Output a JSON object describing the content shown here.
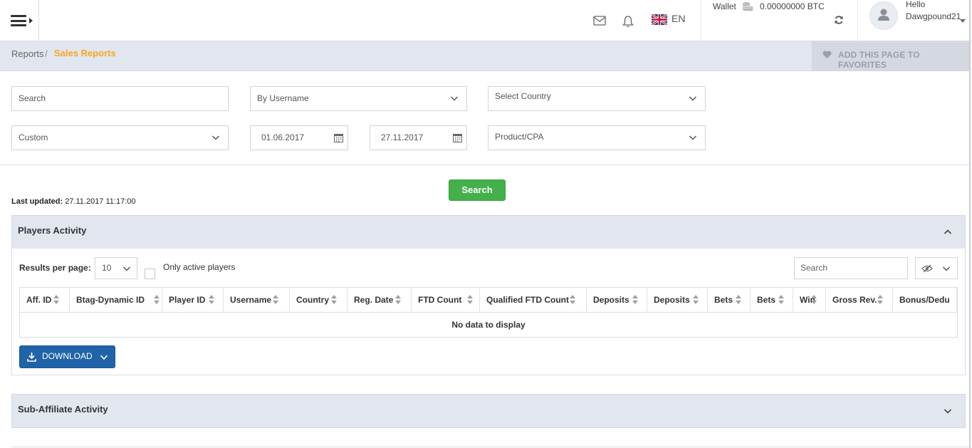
{
  "header": {
    "language": "EN",
    "wallet_label": "Wallet",
    "wallet_value": "0.00000000  BTC",
    "greeting": "Hello",
    "username": "Dawgpound21"
  },
  "breadcrumb": {
    "parent": "Reports",
    "separator": "/",
    "current": "Sales Reports",
    "favorites_label": "ADD THIS PAGE TO FAVORITES"
  },
  "filters": {
    "search_placeholder": "Search",
    "by_username": "By Username",
    "country": "Select Country",
    "period": "Custom",
    "date_from": "01.06.2017",
    "date_to": "27.11.2017",
    "product": "Product/CPA"
  },
  "search_button": "Search",
  "last_updated": {
    "label": "Last updated:",
    "value": "27.11.2017 11:17:00"
  },
  "players_activity": {
    "title": "Players Activity",
    "results_per_page_label": "Results per page:",
    "results_per_page_value": "10",
    "only_active_label": "Only active players",
    "table_search_placeholder": "Search",
    "columns": [
      "Aff. ID",
      "Btag-Dynamic ID",
      "Player ID",
      "Username",
      "Country",
      "Reg. Date",
      "FTD Count",
      "Qualified FTD Count",
      "Deposits",
      "Deposits",
      "Bets",
      "Bets",
      "Win",
      "Gross Rev.",
      "Bonus/Dedu"
    ],
    "empty_message": "No data to display",
    "download_label": "DOWNLOAD"
  },
  "sub_affiliate": {
    "title": "Sub-Affiliate Activity"
  },
  "colors": {
    "accent_orange": "#f5a623",
    "search_green": "#43b049",
    "download_blue": "#2063a8",
    "panel_bg": "#e2e6ee"
  },
  "icons": [
    "menu-icon",
    "mail-icon",
    "bell-icon",
    "uk-flag-icon",
    "coins-icon",
    "refresh-icon",
    "user-icon",
    "heart-icon",
    "chevron-down-icon",
    "calendar-icon",
    "chevron-up-icon",
    "eye-slash-icon",
    "download-icon",
    "sort-icon"
  ]
}
